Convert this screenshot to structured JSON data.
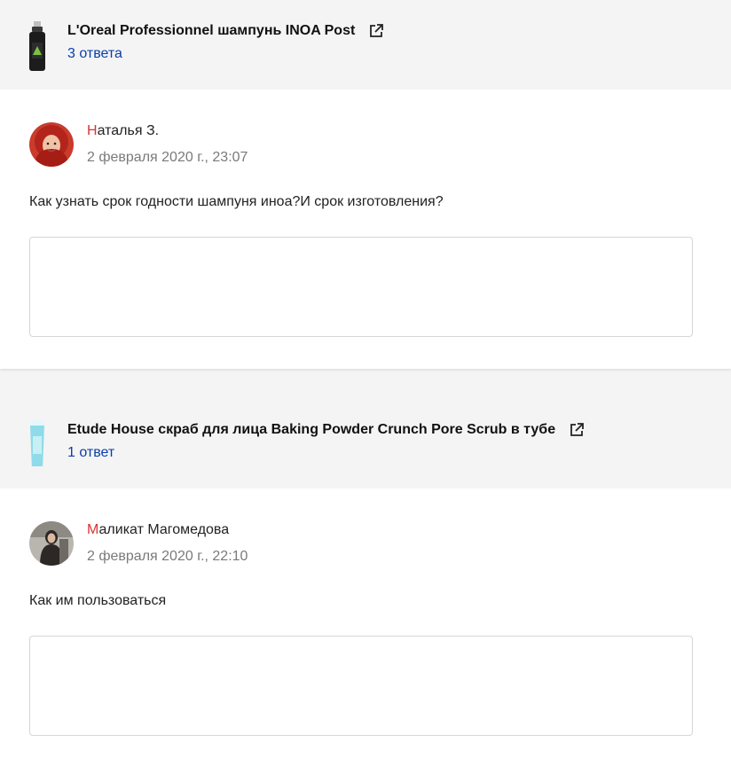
{
  "items": [
    {
      "product": {
        "title": "L'Oreal Professionnel шампунь INOA Post",
        "answers": "3 ответа",
        "icon": "shampoo-bottle-icon"
      },
      "author": {
        "first_letter": "Н",
        "rest": "аталья З."
      },
      "date": "2 февраля 2020 г., 23:07",
      "question": "Как узнать срок годности шампуня иноа?И срок изготовления?"
    },
    {
      "product": {
        "title": "Etude House скраб для лица Baking Powder Crunch Pore Scrub в тубе",
        "answers": "1 ответ",
        "icon": "scrub-tube-icon"
      },
      "author": {
        "first_letter": "М",
        "rest": "аликат Магомедова"
      },
      "date": "2 февраля 2020 г., 22:10",
      "question": "Как им пользоваться"
    }
  ],
  "colors": {
    "link": "#0a3da8",
    "author_initial": "#e0302f",
    "muted": "#7a7a7a",
    "header_bg": "#f4f4f4"
  }
}
